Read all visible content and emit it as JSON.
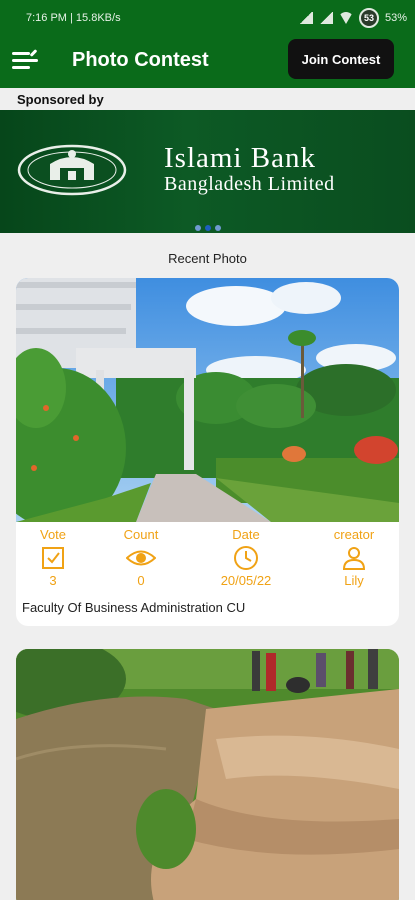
{
  "status": {
    "time_speed": "7:16 PM | 15.8KB/s",
    "battery": "53",
    "battery_pct": "53%"
  },
  "app_bar": {
    "title": "Photo Contest",
    "join_label": "Join Contest"
  },
  "sponsor": {
    "label": "Sponsored by",
    "bank_line1": "Islami Bank",
    "bank_line2": "Bangladesh Limited"
  },
  "carousel": {
    "count": 3,
    "active_index": 1
  },
  "recent": {
    "title": "Recent Photo",
    "posts": [
      {
        "labels": {
          "vote": "Vote",
          "count": "Count",
          "date": "Date",
          "creator": "creator"
        },
        "vote": "3",
        "count": "0",
        "date": "20/05/22",
        "creator": "Lily",
        "caption": "Faculty Of Business Administration CU"
      }
    ]
  },
  "colors": {
    "primary": "#0a6b1a",
    "accent": "#f0a215",
    "button": "#111111"
  },
  "icons": {
    "menu": "menu-icon",
    "vote": "checkbox-icon",
    "count": "eye-icon",
    "date": "clock-icon",
    "creator": "person-icon"
  }
}
